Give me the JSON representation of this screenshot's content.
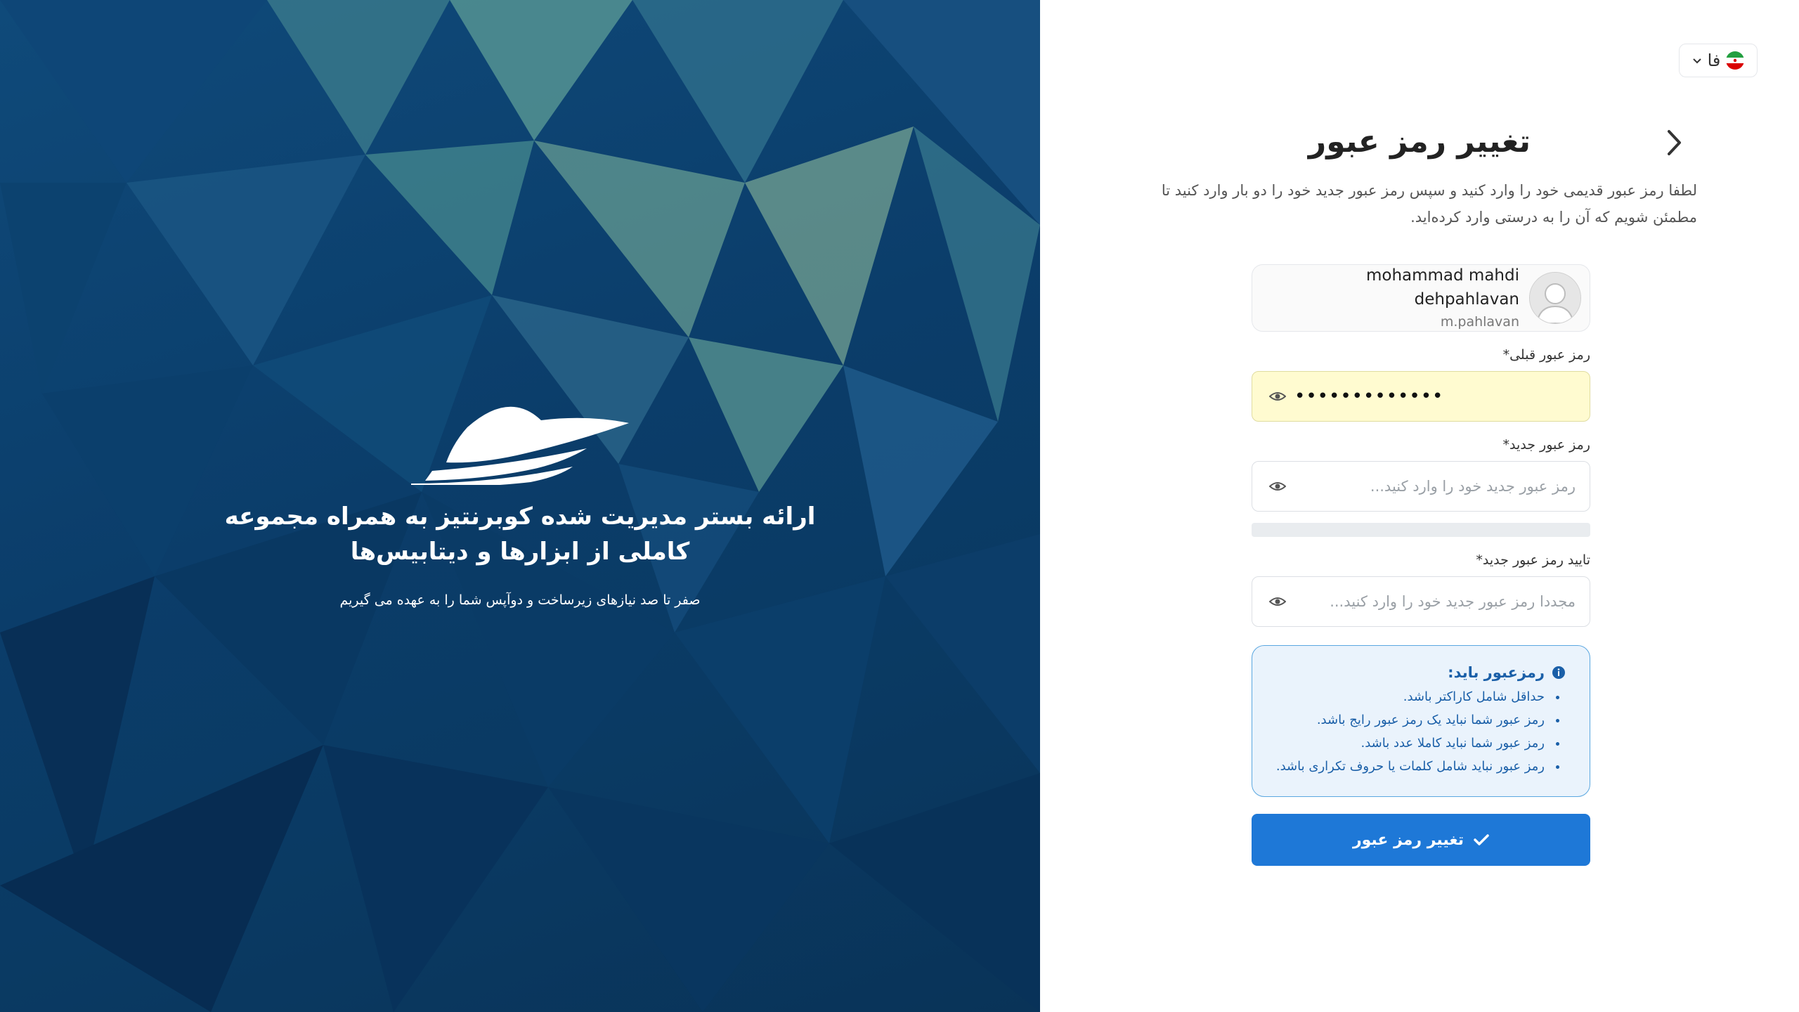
{
  "hero": {
    "title": "ارائه بستر مدیریت شده کوبرنتیز به همراه مجموعه کاملی از ابزارها و دیتابیس‌ها",
    "subtitle": "صفر تا صد نیازهای زیرساخت و دوآپس شما را به عهده می گیریم",
    "background_color": "#0b3d6a"
  },
  "language": {
    "label": "فا",
    "flag": "iran-flag-icon"
  },
  "header": {
    "title": "تغییر رمز عبور",
    "description": "لطفا رمز عبور قدیمی خود را وارد کنید و سپس رمز عبور جدید خود را دو بار وارد کنید تا مطمئن شویم که آن را به درستی وارد کرده‌اید.",
    "back_icon": "chevron-right-icon"
  },
  "user": {
    "name": "mohammad mahdi dehpahlavan",
    "username": "m.pahlavan"
  },
  "fields": {
    "old_password": {
      "label": "رمز عبور قبلی*",
      "value": "•••••••••••••"
    },
    "new_password": {
      "label": "رمز عبور جدید*",
      "placeholder": "رمز عبور جدید خود را وارد کنید..."
    },
    "confirm_password": {
      "label": "تایید رمز عبور جدید*",
      "placeholder": "مجددا رمز عبور جدید خود را وارد کنید..."
    }
  },
  "rules": {
    "title": "رمزعبور باید:",
    "items": [
      "حداقل شامل کاراکتر باشد.",
      "رمز عبور شما نباید یک رمز عبور رایج باشد.",
      "رمز عبور شما نباید کاملا عدد باشد.",
      "رمز عبور نباید شامل کلمات یا حروف تکراری باشد."
    ]
  },
  "submit": {
    "label": "تغییر رمز عبور"
  },
  "colors": {
    "primary": "#1e78d7",
    "info_text": "#1a5fa8",
    "info_bg": "#eaf3fc",
    "autofill_bg": "#fffbd0"
  }
}
